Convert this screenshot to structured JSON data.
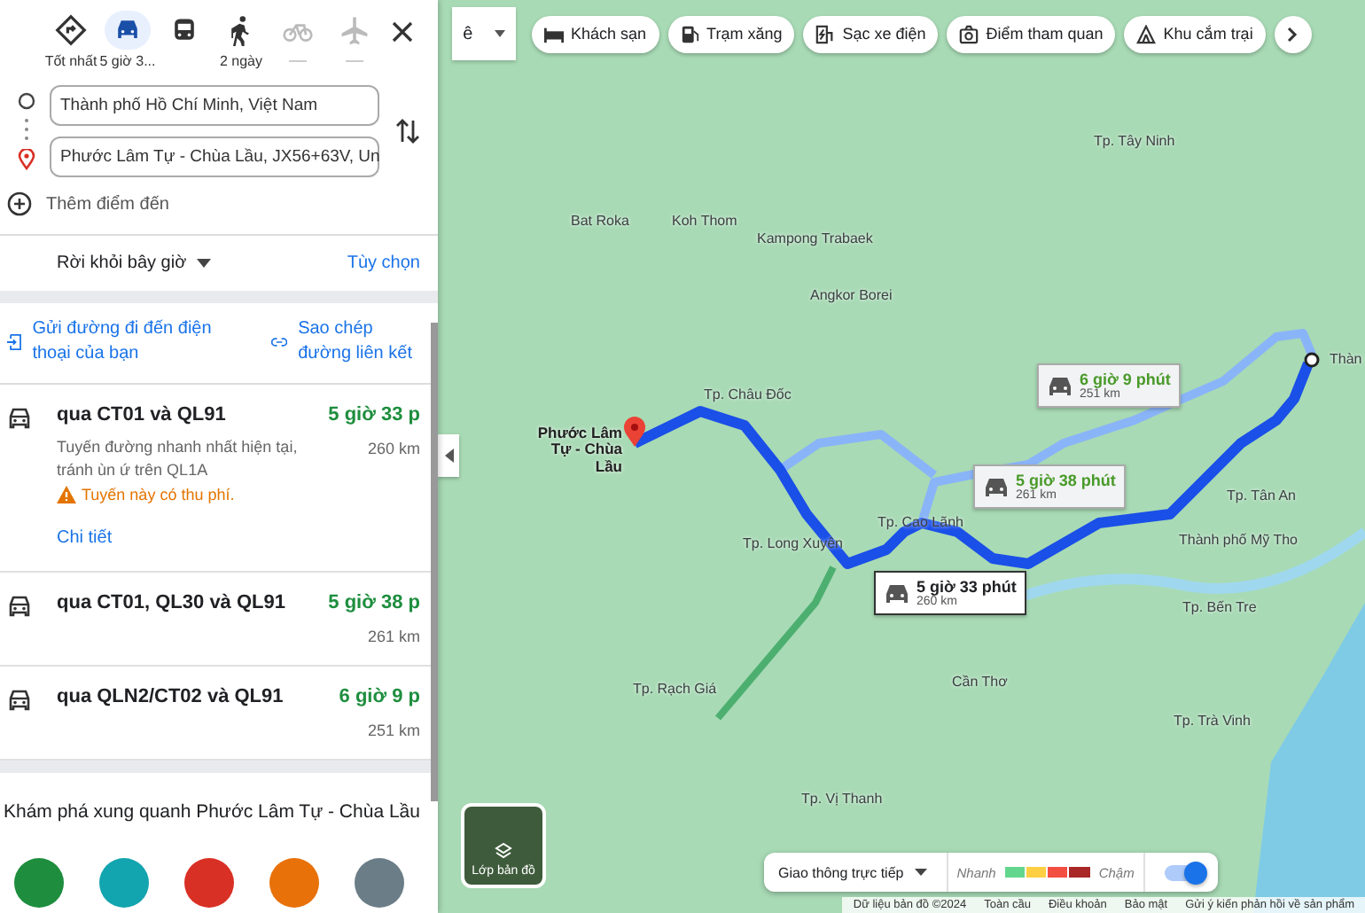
{
  "travel_modes": [
    {
      "kind": "best",
      "label": "Tốt nhất",
      "selected": false,
      "disabled": false
    },
    {
      "kind": "car",
      "label": "5 giờ 3...",
      "selected": true,
      "disabled": false
    },
    {
      "kind": "transit",
      "selected": false,
      "disabled": false
    },
    {
      "kind": "walk",
      "label": "2 ngày",
      "selected": false,
      "disabled": false
    },
    {
      "kind": "bike",
      "selected": false,
      "disabled": true
    },
    {
      "kind": "plane",
      "selected": false,
      "disabled": true
    }
  ],
  "origin": {
    "value": "Thành phố Hồ Chí Minh, Việt Nam"
  },
  "destination": {
    "value": "Phước Lâm Tự - Chùa Lầu, JX56+63V, Un"
  },
  "add_stop": {
    "placeholder": "Thêm điểm đến"
  },
  "depart": {
    "label": "Rời khỏi bây giờ",
    "options": "Tùy chọn"
  },
  "share": {
    "send": "Gửi đường đi đến điện thoại của bạn",
    "copy": "Sao chép đường liên kết"
  },
  "routes": [
    {
      "via": "qua CT01 và QL91",
      "duration": "5 giờ 33 p",
      "distance": "260 km",
      "description": "Tuyến đường nhanh nhất hiện tại, tránh ùn ứ trên QL1A",
      "warning": "Tuyến này có thu phí.",
      "link": "Chi tiết"
    },
    {
      "via": "qua CT01, QL30 và QL91",
      "duration": "5 giờ 38 p",
      "distance": "261 km"
    },
    {
      "via": "qua QLN2/CT02 và QL91",
      "duration": "6 giờ 9 p",
      "distance": "251 km"
    }
  ],
  "explore": {
    "title": "Khám phá xung quanh Phước Lâm Tự - Chùa Lầu",
    "buttons": [
      {
        "color": "#1e8e3e"
      },
      {
        "color": "#12a4af"
      },
      {
        "color": "#d93025"
      },
      {
        "color": "#e8710a"
      },
      {
        "color": "#6b7d87"
      }
    ]
  },
  "map": {
    "search_stub": "ê",
    "chips": [
      {
        "kind": "hotel",
        "label": "Khách sạn"
      },
      {
        "kind": "gas",
        "label": "Trạm xăng"
      },
      {
        "kind": "ev",
        "label": "Sạc xe điện"
      },
      {
        "kind": "camera",
        "label": "Điểm tham quan"
      },
      {
        "kind": "camp",
        "label": "Khu cắm trại"
      }
    ],
    "places": [
      {
        "name": "Tp. Tây Ninh",
        "kind": "town"
      },
      {
        "name": "Bat Roka",
        "kind": "town"
      },
      {
        "name": "Koh Thom",
        "kind": "town"
      },
      {
        "name": "Kampong Trabaek",
        "kind": "town"
      },
      {
        "name": "Angkor Borei",
        "kind": "town"
      },
      {
        "name": "Thàn",
        "kind": "town"
      },
      {
        "name": "Tp. Châu Đốc",
        "kind": "town"
      },
      {
        "name": "Phước Lâm Tự - Chùa Lầu",
        "kind": "destination"
      },
      {
        "name": "Tp. Tân An",
        "kind": "town"
      },
      {
        "name": "Tp. Cao Lãnh",
        "kind": "town"
      },
      {
        "name": "Tp. Long Xuyên",
        "kind": "town"
      },
      {
        "name": "Thành phố Mỹ Tho",
        "kind": "town"
      },
      {
        "name": "Tp. Bến Tre",
        "kind": "town"
      },
      {
        "name": "Cần Thơ",
        "kind": "town"
      },
      {
        "name": "Tp. Rạch Giá",
        "kind": "town"
      },
      {
        "name": "Tp. Trà Vinh",
        "kind": "town"
      },
      {
        "name": "Tp. Vị Thanh",
        "kind": "town"
      }
    ],
    "callouts": [
      {
        "duration": "5 giờ 33 phút",
        "distance": "260 km",
        "selected": true
      },
      {
        "duration": "5 giờ 38 phút",
        "distance": "261 km",
        "selected": false
      },
      {
        "duration": "6 giờ 9 phút",
        "distance": "251 km",
        "selected": false
      }
    ],
    "layers": "Lớp bản đồ",
    "traffic": {
      "label": "Giao thông trực tiếp",
      "fast": "Nhanh",
      "slow": "Chậm",
      "on": true
    },
    "footer": [
      "Dữ liệu bản đồ ©2024",
      "Toàn cầu",
      "Điều khoản",
      "Bảo mật",
      "Gửi ý kiến phản hồi về sản phẩm"
    ]
  }
}
